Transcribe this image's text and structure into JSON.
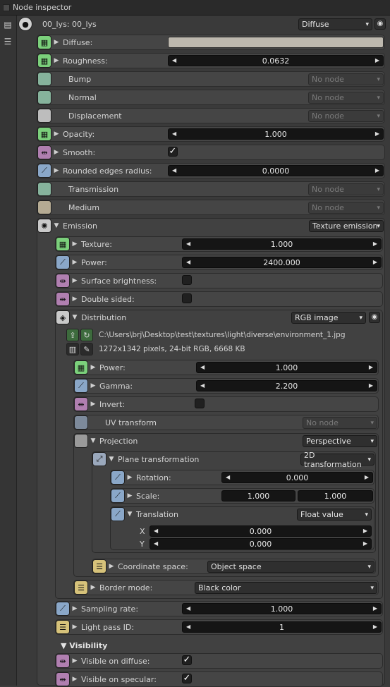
{
  "window": {
    "title": "Node inspector"
  },
  "header": {
    "node_name": "00_lys: 00_lys",
    "type": "Diffuse"
  },
  "rows": {
    "diffuse": {
      "label": "Diffuse:"
    },
    "roughness": {
      "label": "Roughness:",
      "value": "0.0632"
    },
    "bump": {
      "label": "Bump",
      "node": "No node"
    },
    "normal": {
      "label": "Normal",
      "node": "No node"
    },
    "displacement": {
      "label": "Displacement",
      "node": "No node"
    },
    "opacity": {
      "label": "Opacity:",
      "value": "1.000"
    },
    "smooth": {
      "label": "Smooth:",
      "check": "✓"
    },
    "rounded": {
      "label": "Rounded edges radius:",
      "value": "0.0000"
    },
    "transmission": {
      "label": "Transmission",
      "node": "No node"
    },
    "medium": {
      "label": "Medium",
      "node": "No node"
    },
    "emission": {
      "label": "Emission",
      "type": "Texture emission"
    },
    "em_texture": {
      "label": "Texture:",
      "value": "1.000"
    },
    "em_power": {
      "label": "Power:",
      "value": "2400.000"
    },
    "surface_brightness": {
      "label": "Surface brightness:"
    },
    "double_sided": {
      "label": "Double sided:"
    },
    "distribution": {
      "label": "Distribution",
      "type": "RGB image"
    },
    "file_path": "C:\\Users\\brj\\Desktop\\test\\textures\\light\\diverse\\environment_1.jpg",
    "file_info": "1272x1342 pixels, 24-bit RGB, 6668 KB",
    "d_power": {
      "label": "Power:",
      "value": "1.000"
    },
    "d_gamma": {
      "label": "Gamma:",
      "value": "2.200"
    },
    "d_invert": {
      "label": "Invert:"
    },
    "uv_transform": {
      "label": "UV transform",
      "node": "No node"
    },
    "projection": {
      "label": "Projection",
      "type": "Perspective"
    },
    "plane_transformation": {
      "label": "Plane transformation",
      "type": "2D transformation"
    },
    "rotation": {
      "label": "Rotation:",
      "value": "0.000"
    },
    "scale": {
      "label": "Scale:",
      "x": "1.000",
      "y": "1.000"
    },
    "translation": {
      "label": "Translation",
      "type": "Float value",
      "x_label": "X",
      "x": "0.000",
      "y_label": "Y",
      "y": "0.000"
    },
    "coordinate_space": {
      "label": "Coordinate space:",
      "type": "Object space"
    },
    "border_mode": {
      "label": "Border mode:",
      "type": "Black color"
    },
    "sampling_rate": {
      "label": "Sampling rate:",
      "value": "1.000"
    },
    "light_pass_id": {
      "label": "Light pass ID:",
      "value": "1"
    }
  },
  "visibility": {
    "title": "▼ Visibility",
    "diffuse": {
      "label": "Visible on diffuse:",
      "check": "✓"
    },
    "specular": {
      "label": "Visible on specular:",
      "check": "✓"
    }
  },
  "icons": {
    "tri_right": "▶",
    "tri_down": "▼",
    "caret": "▾",
    "left": "◀",
    "right": "▶"
  },
  "colors": {
    "texture": "#7bd07b",
    "float": "#8aa7c8",
    "bool": "#b07fb0",
    "int": "#d6c27a"
  }
}
